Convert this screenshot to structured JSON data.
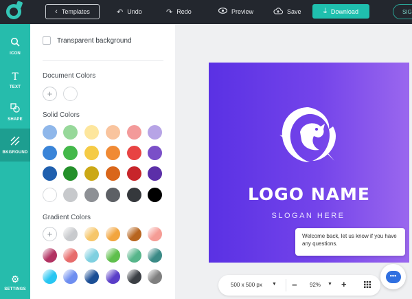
{
  "toolbar": {
    "templates_label": "Templates",
    "undo_label": "Undo",
    "redo_label": "Redo",
    "preview_label": "Preview",
    "save_label": "Save",
    "download_label": "Download",
    "signin_label": "SIG"
  },
  "sidebar": {
    "items": [
      {
        "label": "ICON",
        "icon": "search-icon"
      },
      {
        "label": "TEXT",
        "icon": "text-icon"
      },
      {
        "label": "SHAPE",
        "icon": "shapes-icon"
      },
      {
        "label": "BKGROUND",
        "icon": "background-icon"
      },
      {
        "label": "SETTINGS",
        "icon": "gear-icon"
      }
    ]
  },
  "panel": {
    "transparent_label": "Transparent background",
    "document_title": "Document Colors",
    "solid_title": "Solid Colors",
    "gradient_title": "Gradient Colors",
    "add_symbol": "+",
    "solid_colors": [
      [
        "#8fb7ea",
        "#97d89a",
        "#fde69d",
        "#f9c49e",
        "#f39a9a",
        "#b7a4e6"
      ],
      [
        "#3a84d8",
        "#43b84a",
        "#f5cb45",
        "#f08a34",
        "#e84343",
        "#7a4fc8"
      ],
      [
        "#1f5fae",
        "#24902a",
        "#cba815",
        "#d9661a",
        "#c7252a",
        "#5b2fa8"
      ],
      [
        "#ffffff",
        "#c7c9cc",
        "#8d9095",
        "#5d6065",
        "#35383c",
        "#000000"
      ]
    ],
    "gradient_colors": [
      [
        "#c8cacd",
        "#f6c66a",
        "#f2a53e",
        "#b7651f",
        "#f59c95"
      ],
      [
        "#b23262",
        "#e76c6c",
        "#7fd0e0",
        "#5fbf4c",
        "#56b58a",
        "#3a8a86"
      ],
      [
        "#28c6f2",
        "#6e8ef0",
        "#1b4e95",
        "#5a3ec8",
        "#3b3f44",
        "#7f7f7f"
      ]
    ]
  },
  "canvas": {
    "logo_name": "LOGO NAME",
    "slogan": "SLOGAN HERE",
    "gradient_start": "#5a31e4",
    "gradient_end": "#9a67ee"
  },
  "chat": {
    "message": "Welcome back, let us know if you have any questions."
  },
  "bottom_bar": {
    "size_label": "500 x 500 px",
    "zoom_label": "92%",
    "minus": "−",
    "plus": "+"
  }
}
